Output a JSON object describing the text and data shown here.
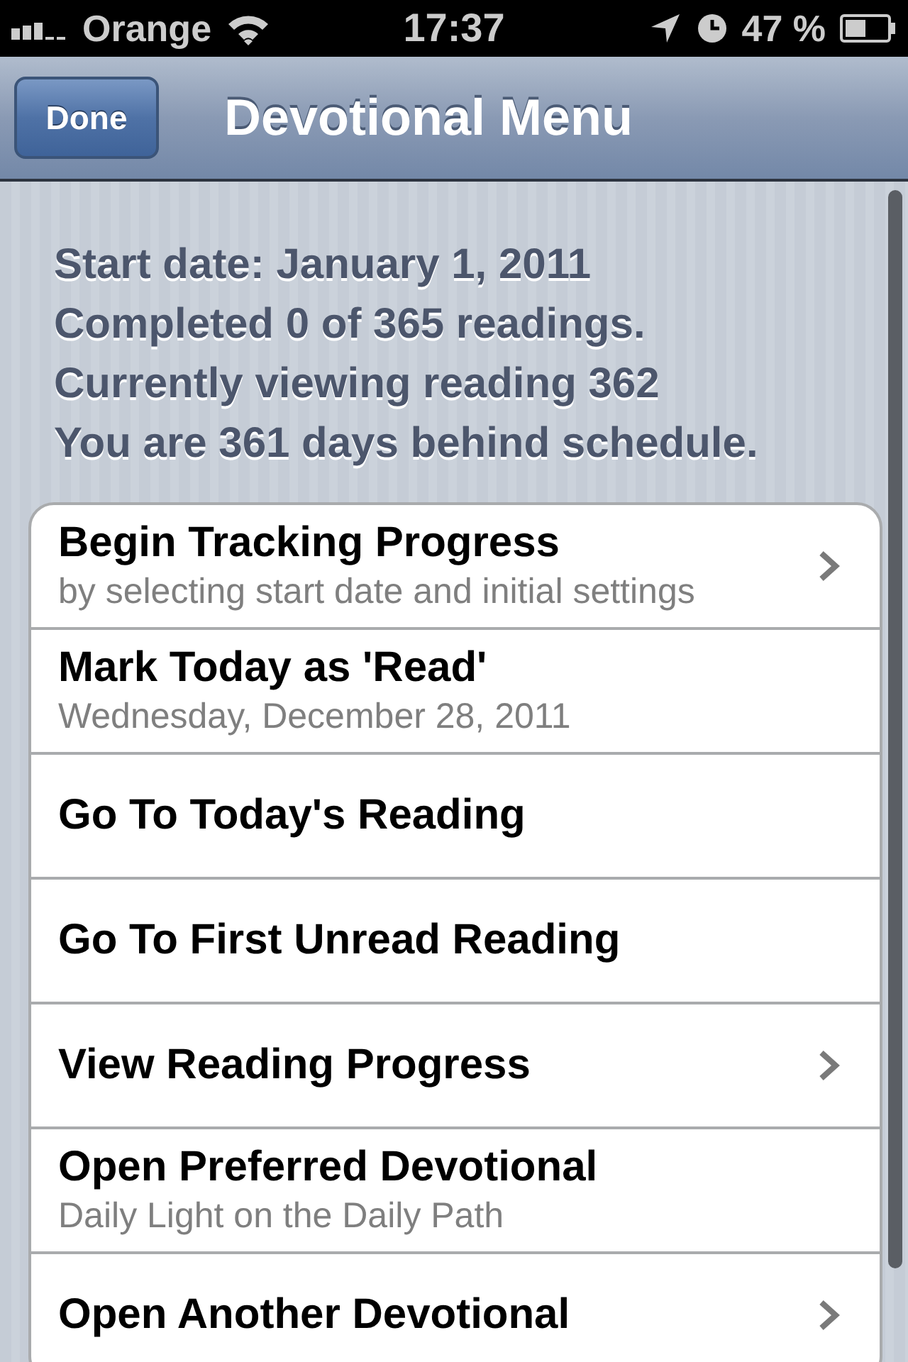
{
  "status_bar": {
    "carrier": "Orange",
    "time": "17:37",
    "battery": "47 %"
  },
  "nav_bar": {
    "title": "Devotional Menu",
    "done_button": "Done"
  },
  "summary": [
    "Start date: January 1, 2011",
    "Completed 0 of 365 readings.",
    "Currently viewing reading 362",
    "You are 361 days behind schedule."
  ],
  "menu": [
    {
      "title": "Begin Tracking Progress",
      "subtitle": "by selecting start date and initial settings",
      "disclosure": true
    },
    {
      "title": "Mark Today as 'Read'",
      "subtitle": "Wednesday, December 28, 2011",
      "disclosure": false
    },
    {
      "title": "Go To Today's Reading",
      "disclosure": false
    },
    {
      "title": "Go To First Unread Reading",
      "disclosure": false
    },
    {
      "title": "View Reading Progress",
      "disclosure": true
    },
    {
      "title": "Open Preferred Devotional",
      "subtitle": "Daily Light on the Daily Path",
      "disclosure": false
    },
    {
      "title": "Open Another Devotional",
      "disclosure": true
    }
  ]
}
